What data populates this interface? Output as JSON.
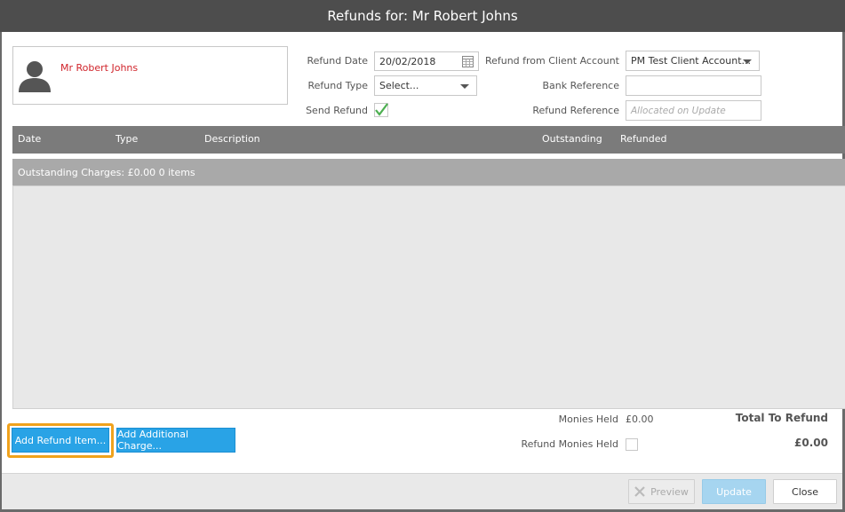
{
  "title": "Refunds for: Mr Robert Johns",
  "client": {
    "name": "Mr Robert Johns"
  },
  "form": {
    "refund_date_label": "Refund Date",
    "refund_date_value": "20/02/2018",
    "refund_type_label": "Refund Type",
    "refund_type_value": "Select...",
    "send_refund_label": "Send Refund",
    "send_refund_checked": true,
    "refund_from_label": "Refund from Client Account",
    "refund_from_value": "PM Test Client Account...",
    "bank_reference_label": "Bank Reference",
    "bank_reference_value": "",
    "refund_reference_label": "Refund Reference",
    "refund_reference_placeholder": "Allocated on Update"
  },
  "grid": {
    "columns": [
      "Date",
      "Type",
      "Description",
      "Outstanding",
      "Refunded"
    ],
    "group_label": "Outstanding Charges: £0.00 0 items"
  },
  "totals": {
    "monies_held_label": "Monies Held",
    "monies_held_value": "£0.00",
    "refund_monies_held_label": "Refund Monies Held",
    "refund_monies_held_checked": false,
    "total_label": "Total To Refund",
    "total_value": "£0.00"
  },
  "buttons": {
    "add_refund_item": "Add Refund Item...",
    "add_additional_charge": "Add Additional Charge...",
    "preview": "Preview",
    "update": "Update",
    "close": "Close"
  },
  "colors": {
    "title_bar": "#4d4d4d",
    "accent_blue": "#29a3e6",
    "client_name": "#d0242b",
    "highlight": "#f0a21c",
    "check_green": "#4caf50"
  }
}
